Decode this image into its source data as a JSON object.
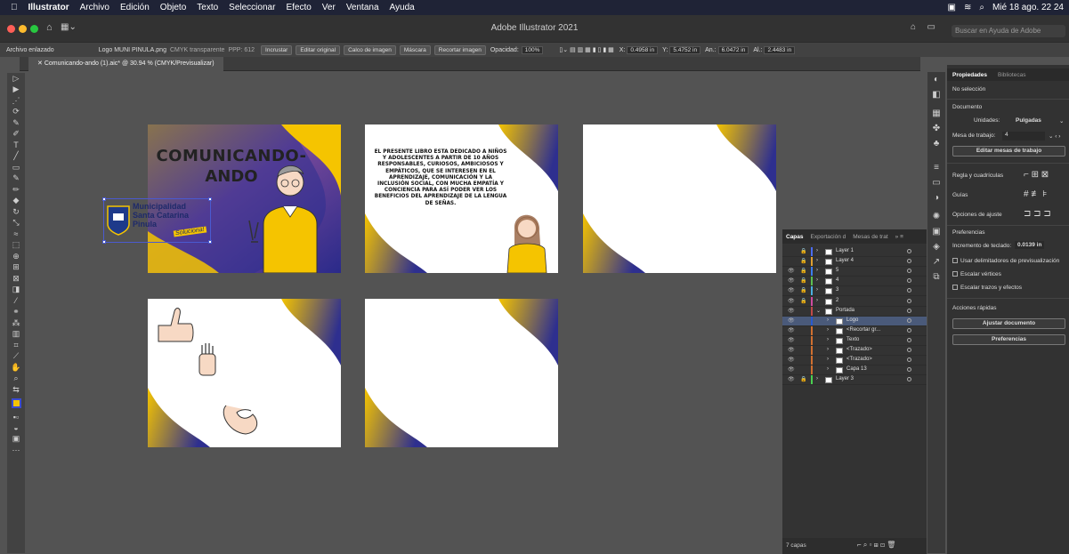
{
  "menubar": {
    "app": "Illustrator",
    "items": [
      "Archivo",
      "Edición",
      "Objeto",
      "Texto",
      "Seleccionar",
      "Efecto",
      "Ver",
      "Ventana",
      "Ayuda"
    ],
    "clock": "Mié 18 ago. 22 24"
  },
  "titlebar": {
    "title": "Adobe Illustrator 2021",
    "help_placeholder": "Buscar en Ayuda de Adobe"
  },
  "controlbar": {
    "object_type": "Archivo enlazado",
    "file_name": "Logo MUNI PINULA.png",
    "mode": "CMYK transparente",
    "ppp": "PPP: 612",
    "embed": "Incrustar",
    "edit_original": "Editar original",
    "image_trace": "Calco de imagen",
    "mask": "Máscara",
    "crop": "Recortar imagen",
    "opacity_label": "Opacidad:",
    "opacity": "100%",
    "x_label": "X:",
    "x": "0.4958 in",
    "y_label": "Y:",
    "y": "5.4752 in",
    "w_label": "An.:",
    "w": "6.0472 in",
    "h_label": "Al.:",
    "h": "2.4483 in"
  },
  "document_tab": {
    "label": "Comunicando-ando (1).aic* @ 30.94 % (CMYK/Previsualizar)"
  },
  "artboards": {
    "cover_title_1": "COMUNICANDO-",
    "cover_title_2": "ANDO",
    "logo_line1": "Municipalidad",
    "logo_line2": "Santa Catarina",
    "logo_line3": "Pinula",
    "logo_slogan": "Soluciona!",
    "dedication": "EL PRESENTE LIBRO ESTA DEDICADO A NIÑOS Y ADOLESCENTES A PARTIR DE 10 AÑOS RESPONSABLES, CURIOSOS, AMBICIOSOS Y EMPÁTICOS, QUE SE INTERESEN EN EL APRENDIZAJE, COMUNICACIÓN Y LA INCLUSIÓN SOCIAL, CON MUCHA EMPATÍA Y CONCIENCIA PARA ASÍ PODER VER LOS BENEFICIOS DEL APRENDIZAJE DE LA LENGUA DE SEÑAS."
  },
  "properties": {
    "tab_properties": "Propiedades",
    "tab_libraries": "Bibliotecas",
    "no_selection": "No selección",
    "document": "Documento",
    "units_label": "Unidades:",
    "units_value": "Pulgadas",
    "artboard_label": "Mesa de trabajo:",
    "artboard_value": "4",
    "edit_artboards": "Editar mesas de trabajo",
    "rulers": "Regla y cuadrículas",
    "guides": "Guías",
    "snap": "Opciones de ajuste",
    "preferences": "Preferencias",
    "keyboard_increment_label": "Incremento de teclado:",
    "keyboard_increment": "0.0139 in",
    "pref_preview_bounds": "Usar delimitadores de previsualización",
    "pref_scale_corners": "Escalar vértices",
    "pref_scale_strokes": "Escalar trazos y efectos",
    "quick_actions": "Acciones rápidas",
    "fit_document": "Ajustar documento",
    "preferences_button": "Preferencias"
  },
  "layers_panel": {
    "tabs": [
      "Capas",
      "Exportación d",
      "Mesas de trat"
    ],
    "rows": [
      {
        "name": "Layer 1",
        "color": "#4a6cf0"
      },
      {
        "name": "Layer 4",
        "color": "#e0a030"
      },
      {
        "name": "5",
        "color": "#3c7cf0"
      },
      {
        "name": "4",
        "color": "#5cc050"
      },
      {
        "name": "3",
        "color": "#4ab0e0"
      },
      {
        "name": "2",
        "color": "#d04aa0"
      },
      {
        "name": "Portada",
        "color": "#c04a4a"
      },
      {
        "name": "Logo",
        "color": "#2a5ad0"
      },
      {
        "name": "<Recortar gr...",
        "color": "#d07030"
      },
      {
        "name": "Texto",
        "color": "#d07030"
      },
      {
        "name": "<Trazado>",
        "color": "#d07030"
      },
      {
        "name": "<Trazado>",
        "color": "#d07030"
      },
      {
        "name": "Capa 13",
        "color": "#d07030"
      },
      {
        "name": "Layer 3",
        "color": "#4ad050"
      }
    ],
    "count": "7 capas"
  },
  "colors": {
    "brand_purple": "#3a2e8a",
    "brand_yellow": "#f5c400"
  }
}
